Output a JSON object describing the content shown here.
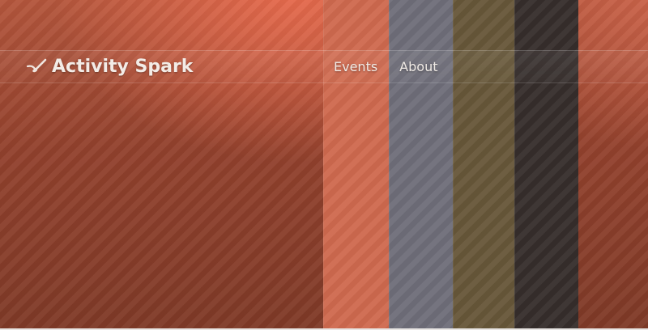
{
  "app": {
    "title": "Activity Spark",
    "logo_icon": "spark-checkmark-icon"
  },
  "nav": {
    "items": [
      {
        "label": "Events"
      },
      {
        "label": "About"
      }
    ]
  },
  "palette": {
    "background": "#92412d",
    "swatches": [
      "#cf6a4f",
      "#6f6e79",
      "#675739",
      "#362e2c"
    ]
  }
}
